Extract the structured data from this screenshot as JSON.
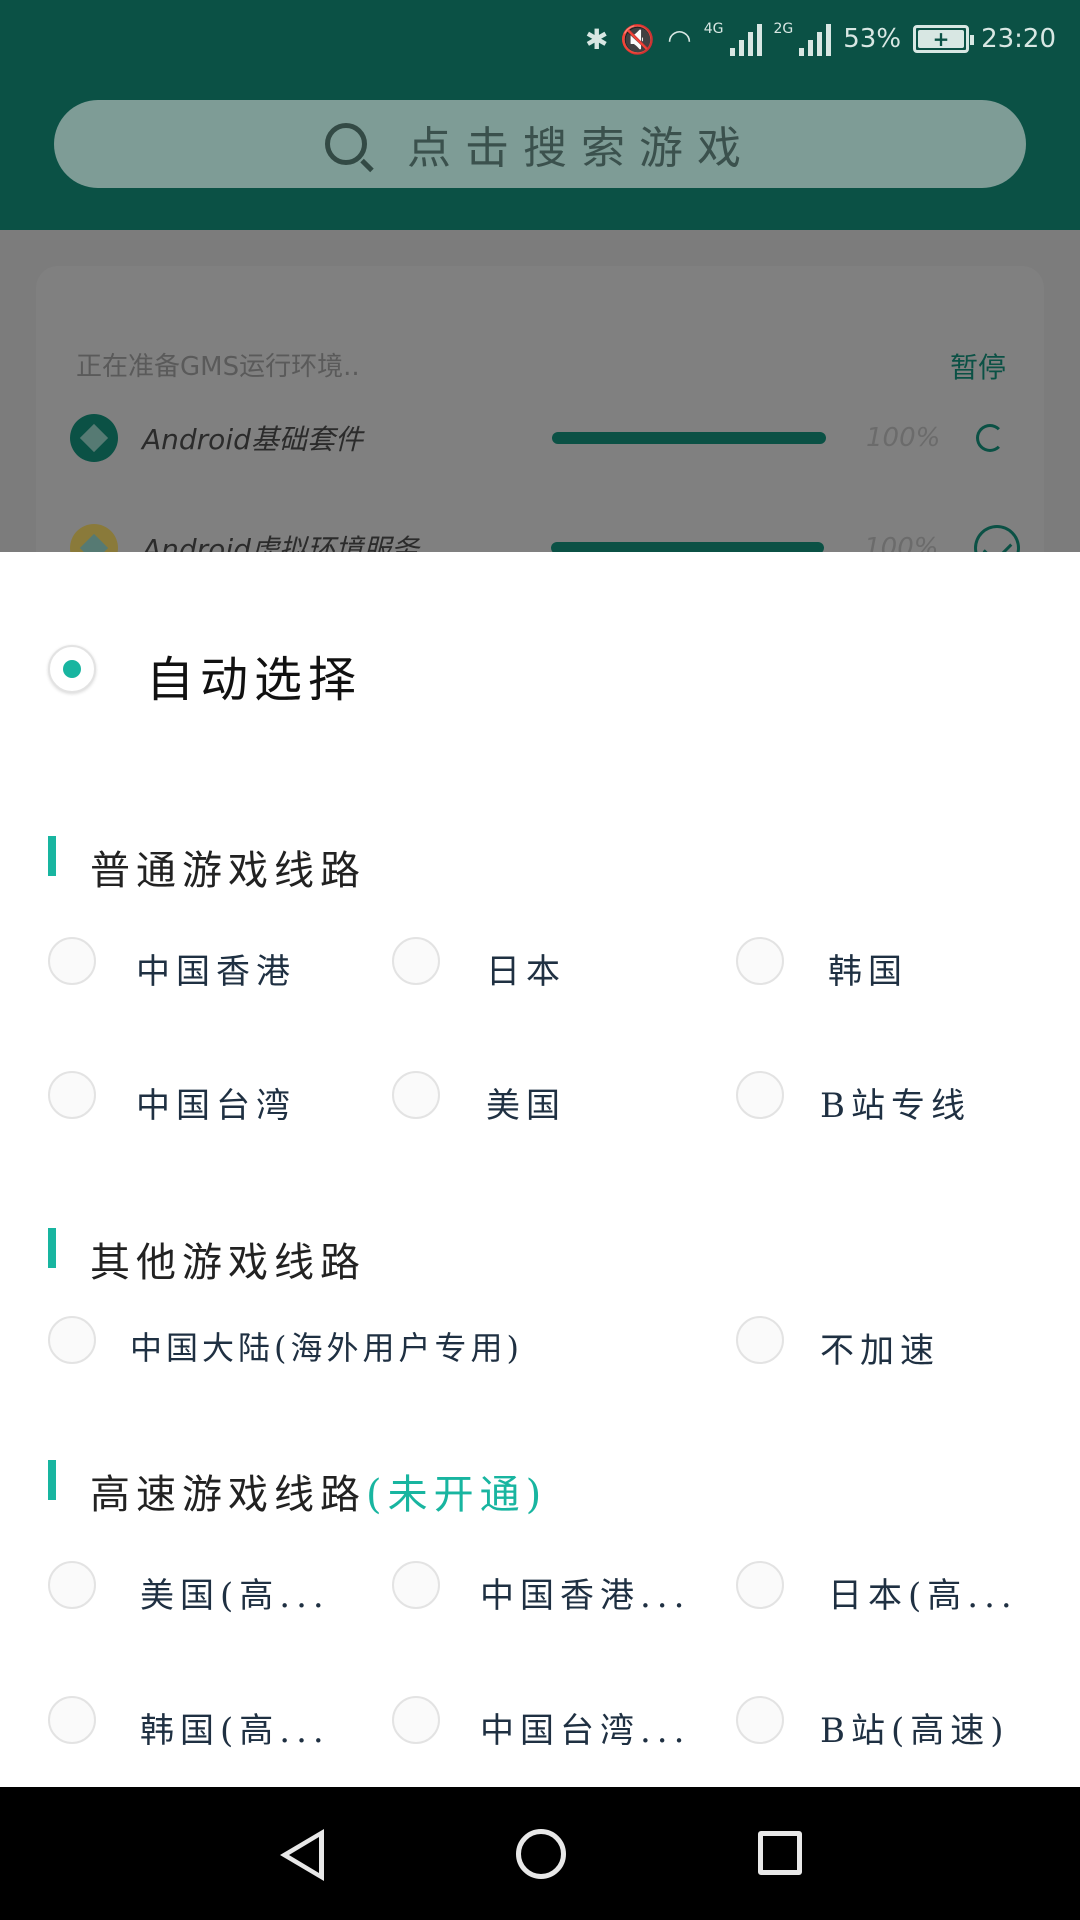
{
  "status_bar": {
    "net_4g": "4G",
    "net_2g": "2G",
    "battery_percent": "53%",
    "time": "23:20"
  },
  "search": {
    "placeholder": "点击搜索游戏"
  },
  "gms_card": {
    "title": "正在准备GMS运行环境..",
    "pause_label": "暂停",
    "tasks": [
      {
        "name": "Android基础套件",
        "percent": "100%",
        "progress": 1.0,
        "status": "loading"
      },
      {
        "name": "Android虚拟环境服务",
        "percent": "100%",
        "progress": 1.0,
        "status": "done"
      }
    ]
  },
  "line_picker": {
    "auto_select": {
      "label": "自动选择",
      "checked": true
    },
    "sections": [
      {
        "title": "普通游戏线路",
        "options": [
          "中国香港",
          "日本",
          "韩国",
          "中国台湾",
          "美国",
          "B站专线"
        ]
      },
      {
        "title": "其他游戏线路",
        "options": [
          "中国大陆(海外用户专用)",
          "不加速"
        ]
      },
      {
        "title": "高速游戏线路",
        "title_note": "(未开通)",
        "options": [
          "美国(高...",
          "中国香港...",
          "日本(高...",
          "韩国(高...",
          "中国台湾...",
          "B站(高速)"
        ]
      }
    ]
  }
}
